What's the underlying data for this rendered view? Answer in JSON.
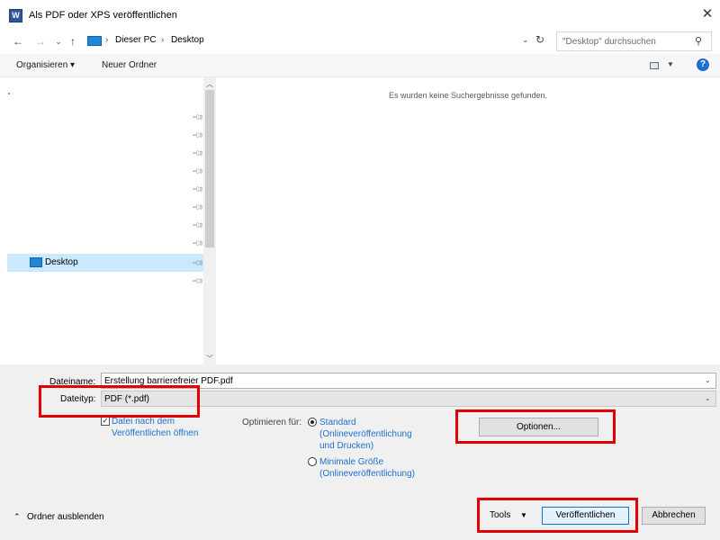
{
  "window": {
    "title": "Als PDF oder XPS veröffentlichen",
    "app_icon_letter": "W",
    "close_glyph": "✕"
  },
  "address": {
    "separator": "›",
    "crumbs": [
      "Dieser PC",
      "Desktop"
    ],
    "search_placeholder": "\"Desktop\" durchsuchen"
  },
  "toolbar": {
    "organize": "Organisieren ▾",
    "new_folder": "Neuer Ordner",
    "help": "?"
  },
  "nav": {
    "selected_item": "Desktop"
  },
  "file_list": {
    "empty_message": "Es wurden keine Suchergebnisse gefunden."
  },
  "form": {
    "filename_label": "Dateiname:",
    "filename_value": "Erstellung barrierefreier PDF.pdf",
    "filetype_label": "Dateityp:",
    "filetype_value": "PDF (*.pdf)",
    "open_after_publish": {
      "checked": true,
      "label": "Datei nach dem Veröffentlichen öffnen"
    },
    "optimize_label": "Optimieren für:",
    "optimize_options": [
      {
        "label": "Standard (Onlineveröffentlichung und Drucken)",
        "selected": true
      },
      {
        "label": "Minimale Größe (Onlineveröffentlichung)",
        "selected": false
      }
    ],
    "options_button": "Optionen..."
  },
  "footer": {
    "hide_folders": "Ordner ausblenden",
    "tools": "Tools",
    "publish": "Veröffentlichen",
    "cancel": "Abbrechen"
  },
  "colors": {
    "accent": "#0078d7",
    "link_blue": "#1e6fd0",
    "highlight_red": "#e00000",
    "selection": "#cce8ff"
  }
}
